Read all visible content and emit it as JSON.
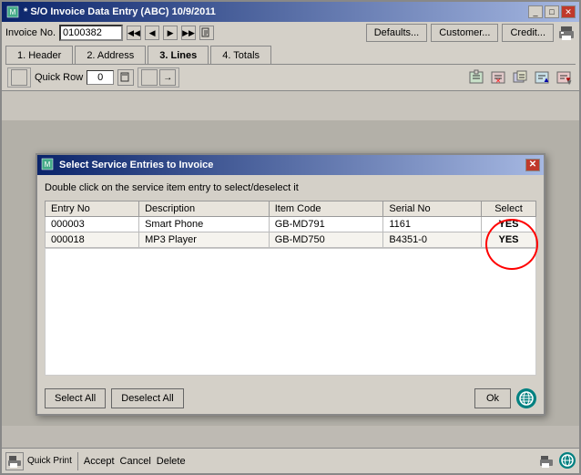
{
  "titleBar": {
    "text": "* S/O Invoice Data Entry (ABC) 10/9/2011",
    "buttons": [
      "_",
      "□",
      "✕"
    ]
  },
  "toolbar": {
    "invoiceLabel": "Invoice No.",
    "invoiceValue": "0100382",
    "navButtons": [
      "◀◀",
      "◀",
      "▶",
      "▶▶"
    ],
    "defaultsBtn": "Defaults...",
    "customerBtn": "Customer...",
    "creditBtn": "Credit..."
  },
  "tabs": [
    {
      "id": 1,
      "label": "1. Header"
    },
    {
      "id": 2,
      "label": "2. Address"
    },
    {
      "id": 3,
      "label": "3. Lines",
      "active": true
    },
    {
      "id": 4,
      "label": "4. Totals"
    }
  ],
  "linesToolbar": {
    "quickRowLabel": "Quick Row",
    "quickRowValue": "0"
  },
  "modal": {
    "title": "Select Service Entries to Invoice",
    "description": "Double click on the service item entry to select/deselect it",
    "columns": [
      "Entry No",
      "Description",
      "Item Code",
      "Serial No",
      "Select"
    ],
    "rows": [
      {
        "entryNo": "000003",
        "description": "Smart Phone",
        "itemCode": "GB-MD791",
        "serialNo": "1161",
        "select": "YES"
      },
      {
        "entryNo": "000018",
        "description": "MP3 Player",
        "itemCode": "GB-MD750",
        "serialNo": "B4351-0",
        "select": "YES"
      }
    ],
    "footer": {
      "selectAllBtn": "Select All",
      "deselectAllBtn": "Deselect All",
      "okBtn": "Ok"
    }
  },
  "taskbar": {
    "acceptLabel": "Accept",
    "cancelLabel": "Cancel",
    "deleteLabel": "Delete",
    "quickPrintLabel": "Quick Print"
  },
  "icons": {
    "windowIcon": "📋",
    "modalIcon": "📋",
    "printerIcon": "🖨",
    "globalIcon": "🌐"
  }
}
